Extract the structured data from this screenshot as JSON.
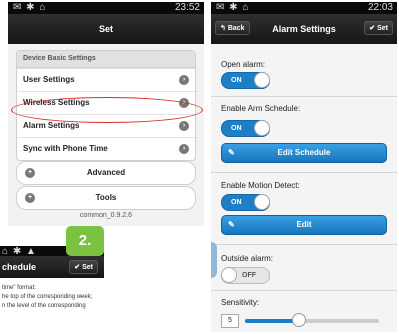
{
  "left_phone": {
    "status_time": "23:52",
    "title": "Set",
    "group_header": "Device Basic Settings",
    "rows": [
      {
        "label": "User Settings"
      },
      {
        "label": "Wireless Settings"
      },
      {
        "label": "Alarm Settings"
      },
      {
        "label": "Sync with Phone Time"
      }
    ],
    "advanced_label": "Advanced",
    "tools_label": "Tools",
    "version": "common_0.9.2.6",
    "highlight_color": "#d92b2b"
  },
  "bottom_phone": {
    "title_fragment": "chedule",
    "set_label": "Set",
    "text_lines": [
      "time\" format;",
      "he top of the corresponding week;",
      "n the level of the corresponding"
    ]
  },
  "badge": {
    "label": "2.",
    "color": "#7cc240"
  },
  "right_phone": {
    "status_time": "22:03",
    "back_label": "Back",
    "title": "Alarm Settings",
    "set_label": "Set",
    "open_alarm": {
      "label": "Open alarm:",
      "state": "ON"
    },
    "arm_schedule": {
      "label": "Enable Arm Schedule:",
      "state": "ON",
      "button": "Edit Schedule"
    },
    "motion_detect": {
      "label": "Enable Motion Detect:",
      "state": "ON",
      "button": "Edit"
    },
    "outside_alarm": {
      "label": "Outside alarm:",
      "state": "OFF"
    },
    "sensitivity": {
      "label": "Sensitivity:",
      "value": "5"
    },
    "accent_color": "#1e7fc7"
  }
}
